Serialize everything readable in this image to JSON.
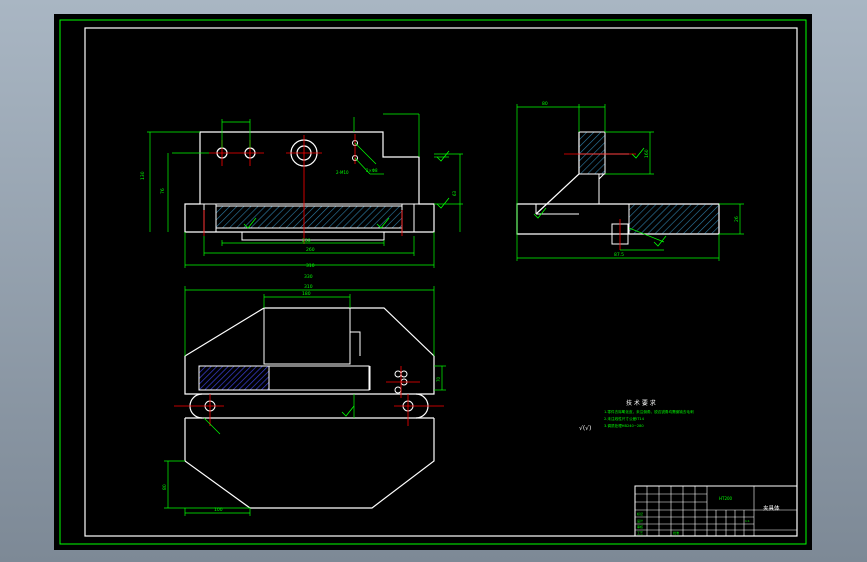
{
  "drawing": {
    "tech_requirements": {
      "title": "技 术 要 求",
      "lines": [
        "1.零件去除氧化皮，未注倒角，锐边锐角均需倒钝去毛刺",
        "2.未注线性尺寸公差IT14",
        "3.调质处理HB240~280"
      ]
    },
    "surface_finish_note": "√(√)",
    "title_block": {
      "part_name": "夹具体",
      "material": "HT200",
      "scale": "1:1",
      "rows": [
        "标记",
        "设计",
        "审核",
        "工艺",
        "批准"
      ]
    },
    "dims_front": {
      "overall": "310",
      "total": "330",
      "inner": "230",
      "lower": "260",
      "height_left": "130",
      "height_mid": "76",
      "thread": "2-M10",
      "hole": "2×Φ8",
      "right_h": "63"
    },
    "dims_side": {
      "top": "80",
      "height": "160",
      "right": "26",
      "bottom": "87.5"
    },
    "dims_plan": {
      "width": "310",
      "top": "180",
      "left_h": "80",
      "bottom": "100",
      "left_bottom": "70"
    }
  },
  "colors": {
    "background": "#000000",
    "line": "#ffffff",
    "dimension": "#00ff00",
    "center": "#ff0000",
    "hatch": "#2f7fa8",
    "frame": "#00ff00"
  }
}
